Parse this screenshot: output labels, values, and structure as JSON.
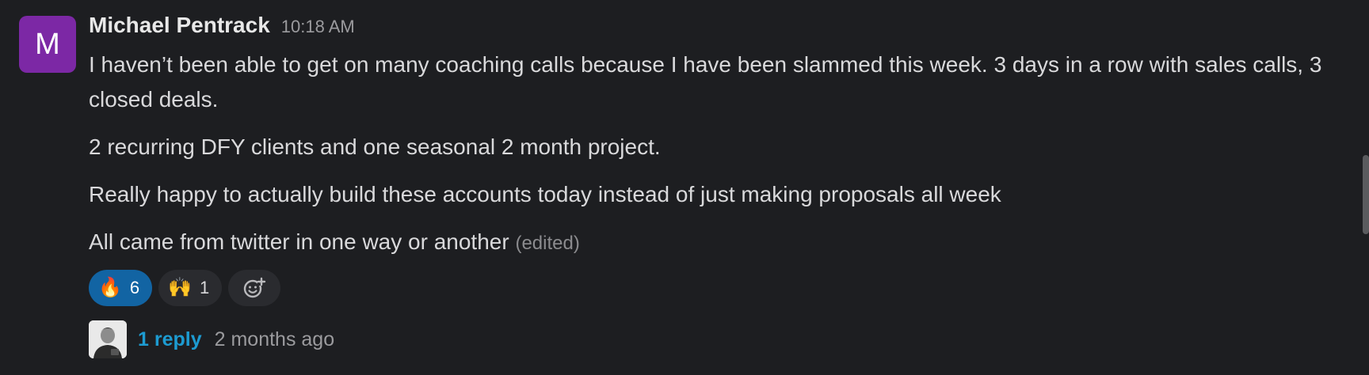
{
  "message": {
    "avatar_letter": "M",
    "author": "Michael Pentrack",
    "timestamp": "10:18 AM",
    "paragraphs": [
      "I haven’t been able to get on many coaching calls because I have been slammed this week. 3 days in a row with sales calls, 3 closed deals.",
      "2 recurring DFY clients and one seasonal 2 month project.",
      "Really happy to actually build these accounts today instead of just making proposals all week",
      "All came from twitter in one way or another"
    ],
    "edited_label": "(edited)"
  },
  "reactions": [
    {
      "emoji": "🔥",
      "count": "6",
      "active": true,
      "icon": "fire-emoji"
    },
    {
      "emoji": "🙌",
      "count": "1",
      "active": false,
      "icon": "raised-hands-emoji"
    }
  ],
  "add_reaction_icon": "add-emoji-icon",
  "thread": {
    "reply_label": "1 reply",
    "reply_time": "2 months ago"
  },
  "colors": {
    "background": "#1d1e21",
    "avatar": "#7c28a5",
    "active_reaction": "#1264a3",
    "link": "#1d9bd1"
  }
}
